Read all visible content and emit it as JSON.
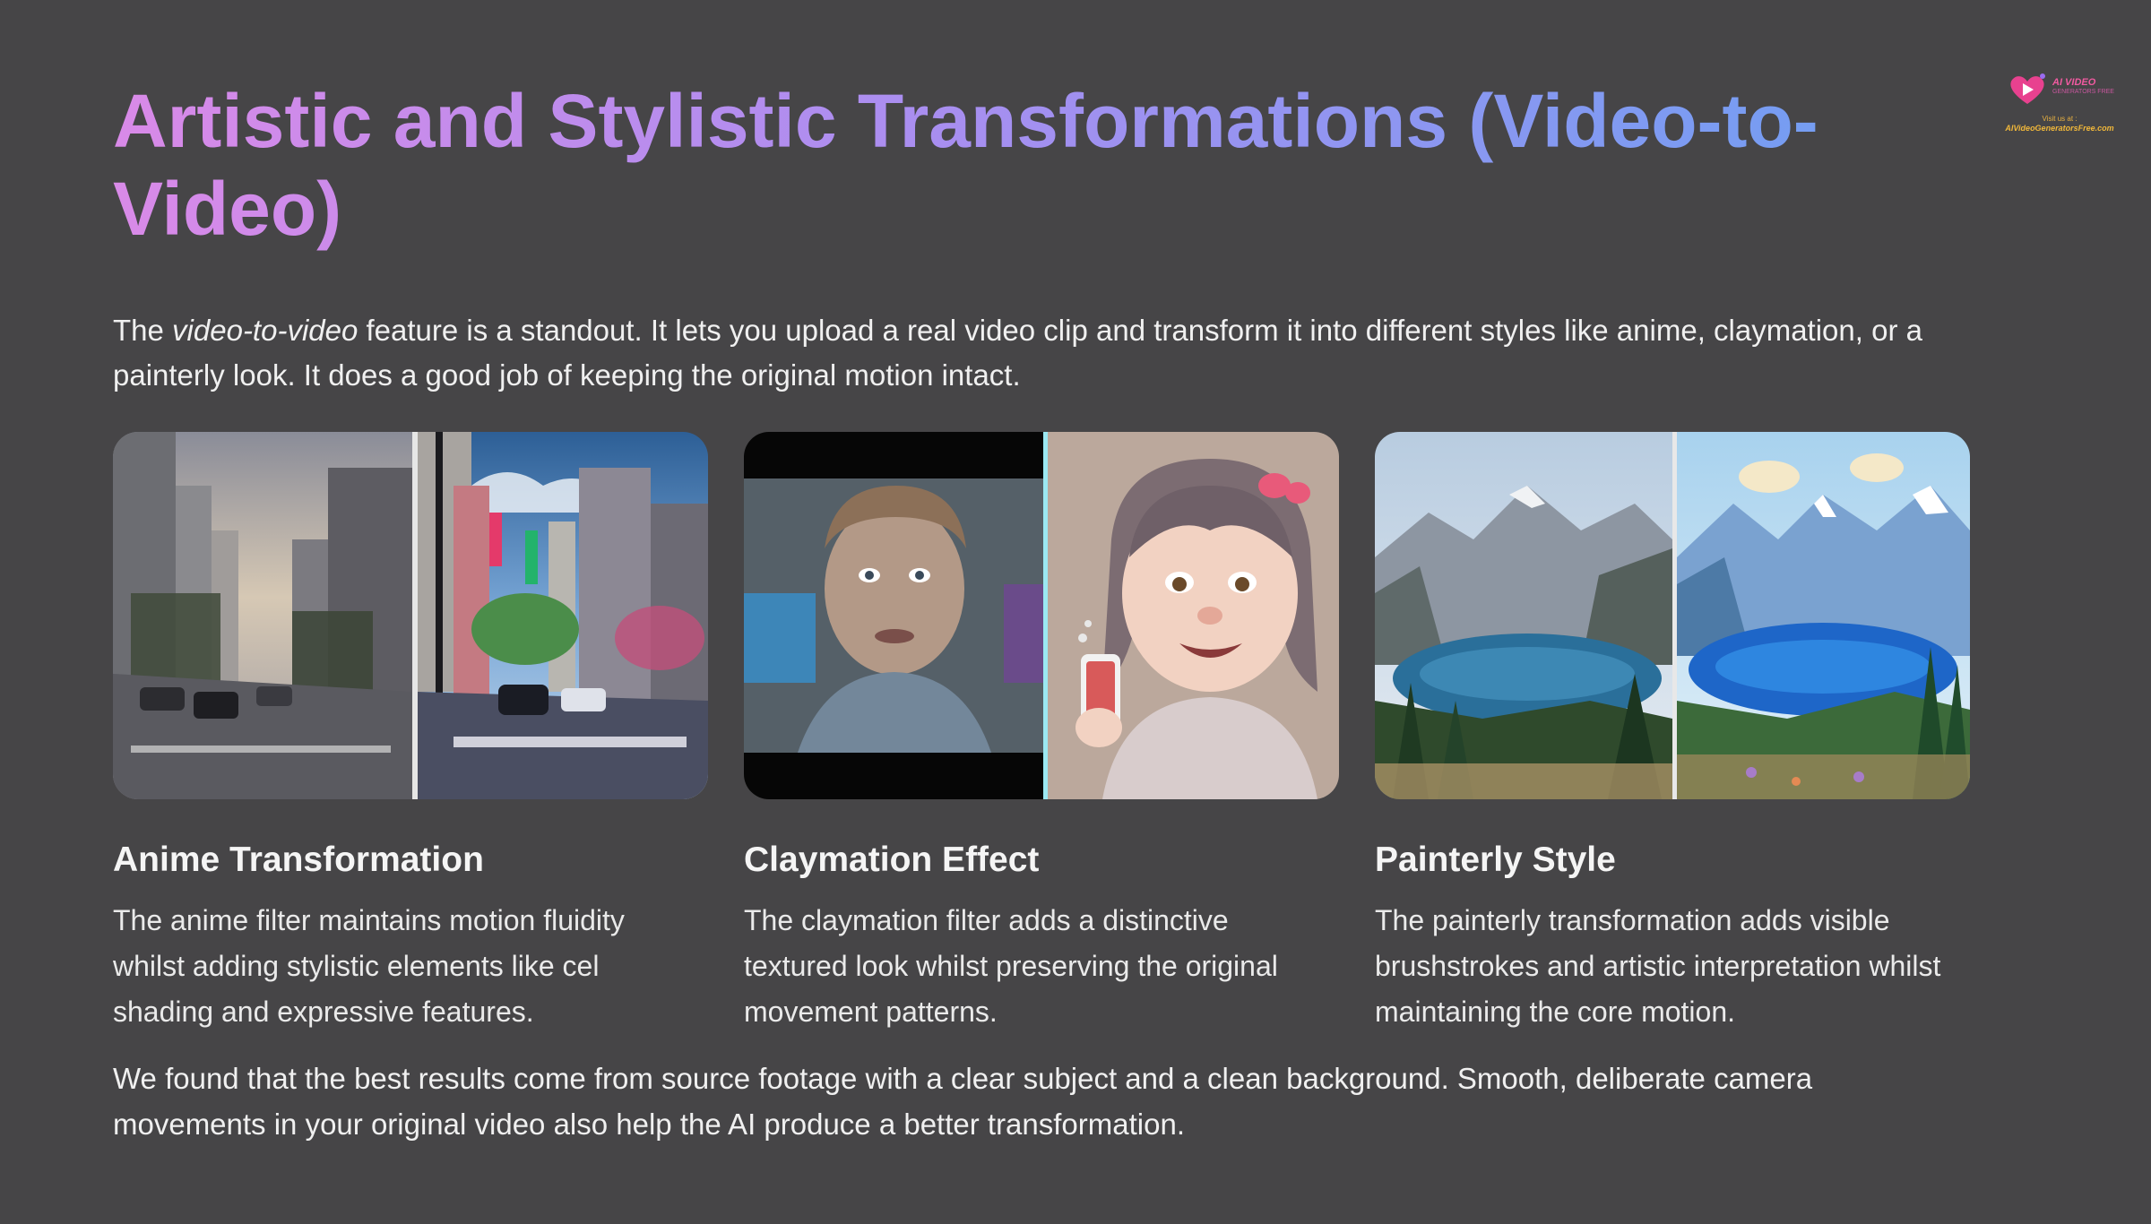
{
  "header": {
    "title": "Artistic and Stylistic Transformations (Video-to-Video)",
    "intro_before": "The ",
    "intro_em": "video-to-video",
    "intro_after": " feature is a standout. It lets you upload a real video clip and transform it into different styles like anime, claymation, or a painterly look. It does a good job of keeping the original motion intact."
  },
  "logo": {
    "name": "AI VIDEO",
    "sub": "GENERATORS FREE",
    "visit": "Visit us at :",
    "url": "AIVideoGeneratorsFree.com"
  },
  "cards": [
    {
      "title": "Anime Transformation",
      "description": "The anime filter maintains motion fluidity whilst adding stylistic elements like cel shading and expressive features.",
      "image_icon": "city-street-anime-comparison-image"
    },
    {
      "title": "Claymation Effect",
      "description": "The claymation filter adds a distinctive textured look whilst preserving the original movement patterns.",
      "image_icon": "portrait-claymation-comparison-image"
    },
    {
      "title": "Painterly Style",
      "description": "The painterly transformation adds visible brushstrokes and artistic interpretation whilst maintaining the core motion.",
      "image_icon": "mountain-lake-painterly-comparison-image"
    }
  ],
  "outro": "We found that the best results come from source footage with a clear subject and a clean background. Smooth, deliberate camera movements in your original video also help the AI produce a better transformation.",
  "colors": {
    "background": "#464547",
    "title_gradient_start": "#d98ae8",
    "title_gradient_end": "#6f9ff2",
    "text": "#f0f0f0"
  }
}
